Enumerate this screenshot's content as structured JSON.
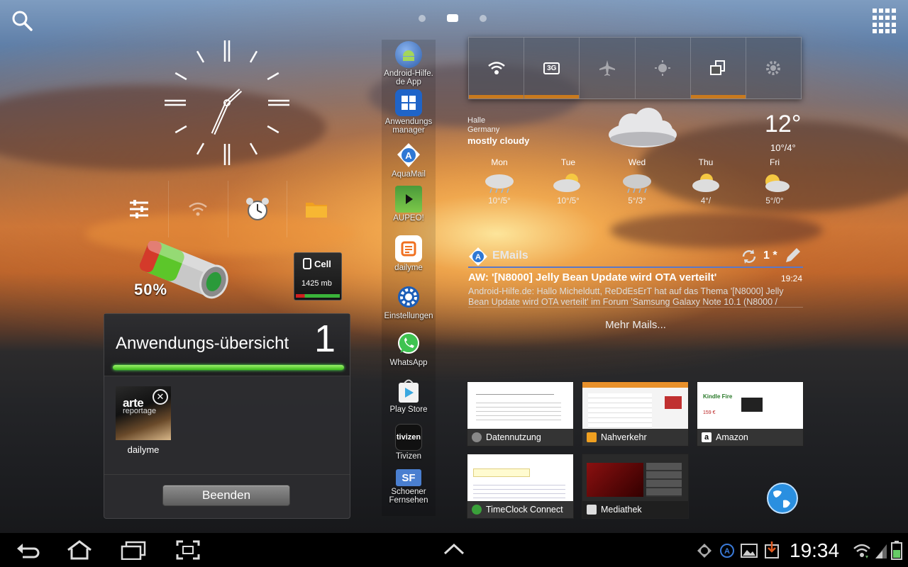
{
  "clock_widget": {
    "hour": 1,
    "minute": 34
  },
  "battery": {
    "label": "50%",
    "level": 0.5
  },
  "cell": {
    "title": "Cell",
    "value": "1425 mb"
  },
  "overview": {
    "title": "Anwendungs-übersicht",
    "count": "1",
    "recent_app_label": "dailyme",
    "thumb_brand": "arte",
    "thumb_sub": "reportage",
    "quit_button": "Beenden"
  },
  "dock": {
    "items": [
      {
        "label_1": "Android-Hilfe.",
        "label_2": "de App",
        "icon": "android-hilfe-icon"
      },
      {
        "label_1": "Anwendungs",
        "label_2": "manager",
        "icon": "app-manager-icon"
      },
      {
        "label_1": "AquaMail",
        "label_2": "",
        "icon": "aquamail-icon"
      },
      {
        "label_1": "AUPEO!",
        "label_2": "",
        "icon": "aupeo-icon"
      },
      {
        "label_1": "dailyme",
        "label_2": "",
        "icon": "dailyme-icon"
      },
      {
        "label_1": "Einstellungen",
        "label_2": "",
        "icon": "settings-icon"
      },
      {
        "label_1": "WhatsApp",
        "label_2": "",
        "icon": "whatsapp-icon"
      },
      {
        "label_1": "Play Store",
        "label_2": "",
        "icon": "play-store-icon"
      },
      {
        "label_1": "Tivizen",
        "label_2": "",
        "icon": "tivizen-icon"
      },
      {
        "label_1": "Schoener",
        "label_2": "Fernsehen",
        "icon": "schoener-fernsehen-icon"
      }
    ],
    "tivizen_icon_text": "tivizen",
    "sf_icon_text": "SF"
  },
  "quick_settings": {
    "network_icon_text": "3G"
  },
  "weather": {
    "city": "Halle",
    "country": "Germany",
    "condition": "mostly cloudy",
    "temp": "12°",
    "range": "10°/4°",
    "forecast": [
      {
        "day": "Mon",
        "temp": "10°/5°"
      },
      {
        "day": "Tue",
        "temp": "10°/5°"
      },
      {
        "day": "Wed",
        "temp": "5°/3°"
      },
      {
        "day": "Thu",
        "temp": "4°/"
      },
      {
        "day": "Fri",
        "temp": "5°/0°"
      }
    ]
  },
  "email": {
    "title": "EMails",
    "count": "1 *",
    "subject": "AW: '[N8000] Jelly Bean Update wird OTA verteilt'",
    "time": "19:24",
    "body": "Android-Hilfe.de: Hallo Micheldutt, ReDdEsErT hat auf das Thema '[N8000] Jelly Bean Update wird OTA verteilt' im Forum 'Samsung Galaxy Note 10.1 (N8000 /",
    "more": "Mehr Mails..."
  },
  "browser_thumbs": [
    {
      "title": "Datennutzung"
    },
    {
      "title": "Nahverkehr"
    },
    {
      "title": "Amazon"
    },
    {
      "title": "TimeClock Connect"
    },
    {
      "title": "Mediathek"
    }
  ],
  "thumb_text": {
    "amazon_heading": "Kindle Fire",
    "amazon_price": "159 €"
  },
  "statusbar": {
    "time": "19:34"
  }
}
